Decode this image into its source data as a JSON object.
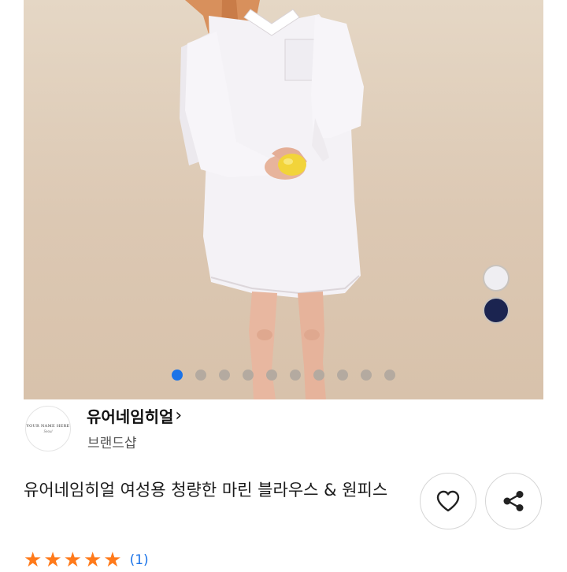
{
  "product_image": {
    "dot_count": 10,
    "active_dot_index": 0,
    "swatches": [
      {
        "name": "white",
        "color": "#efeef2"
      },
      {
        "name": "navy",
        "color": "#1b2450"
      }
    ]
  },
  "brand": {
    "logo_text": "YOUR NAME HERE",
    "logo_signature": "Seoul",
    "name": "유어네임히얼",
    "chevron": "›",
    "type_label": "브랜드샵"
  },
  "product": {
    "title": "유어네임히얼 여성용 청량한 마린 블라우스 & 원피스"
  },
  "actions": {
    "like_icon": "heart-icon",
    "share_icon": "share-icon"
  },
  "rating": {
    "stars": 5,
    "max_stars": 5,
    "review_count": "(1)"
  },
  "colors": {
    "accent_blue": "#1a73e8",
    "star_orange": "#ff7a1a"
  }
}
